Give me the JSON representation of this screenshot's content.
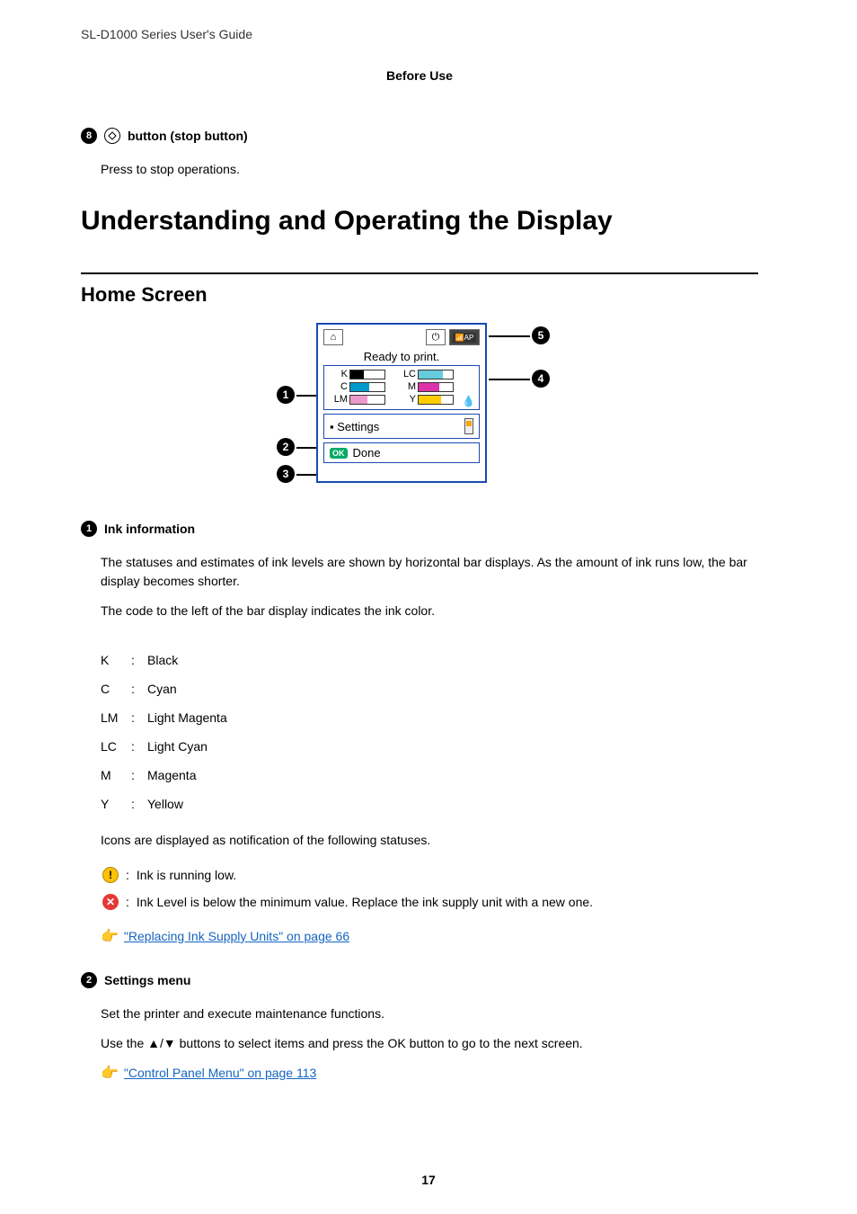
{
  "header": {
    "guide_title": "SL-D1000 Series User's Guide",
    "section": "Before Use"
  },
  "item8": {
    "num": "8",
    "title": " button (stop button)",
    "desc": "Press to stop operations."
  },
  "h1": "Understanding and Operating the Display",
  "h2": "Home Screen",
  "screen": {
    "status": "Ready to print.",
    "settings": "Settings",
    "done": "Done",
    "ok": "OK",
    "inks": {
      "k": "K",
      "lc": "LC",
      "c": "C",
      "m": "M",
      "lm": "LM",
      "y": "Y"
    },
    "callouts": {
      "c1": "1",
      "c2": "2",
      "c3": "3",
      "c4": "4",
      "c5": "5"
    }
  },
  "item1": {
    "num": "1",
    "title": "Ink information",
    "p1": "The statuses and estimates of ink levels are shown by horizontal bar displays. As the amount of ink runs low, the bar display becomes shorter.",
    "p2": "The code to the left of the bar display indicates the ink color.",
    "colors": [
      {
        "code": "K",
        "sep": ":",
        "name": "Black"
      },
      {
        "code": "C",
        "sep": ":",
        "name": "Cyan"
      },
      {
        "code": "LM",
        "sep": ":",
        "name": "Light Magenta"
      },
      {
        "code": "LC",
        "sep": ":",
        "name": "Light Cyan"
      },
      {
        "code": "M",
        "sep": ":",
        "name": "Magenta"
      },
      {
        "code": "Y",
        "sep": ":",
        "name": "Yellow"
      }
    ],
    "p3": "Icons are displayed as notification of the following statuses.",
    "warn_sep": ":",
    "warn": "Ink is running low.",
    "err_sep": ":",
    "err": "Ink Level is below the minimum value. Replace the ink supply unit with a new one.",
    "link": "\"Replacing Ink Supply Units\" on page 66"
  },
  "item2": {
    "num": "2",
    "title": "Settings menu",
    "p1": "Set the printer and execute maintenance functions.",
    "p2_a": "Use the ",
    "p2_b": " buttons to select items and press the ",
    "p2_c": " button to go to the next screen.",
    "arrows": "▲/▼",
    "ok": "OK",
    "link": "\"Control Panel Menu\" on page 113"
  },
  "page_num": "17"
}
